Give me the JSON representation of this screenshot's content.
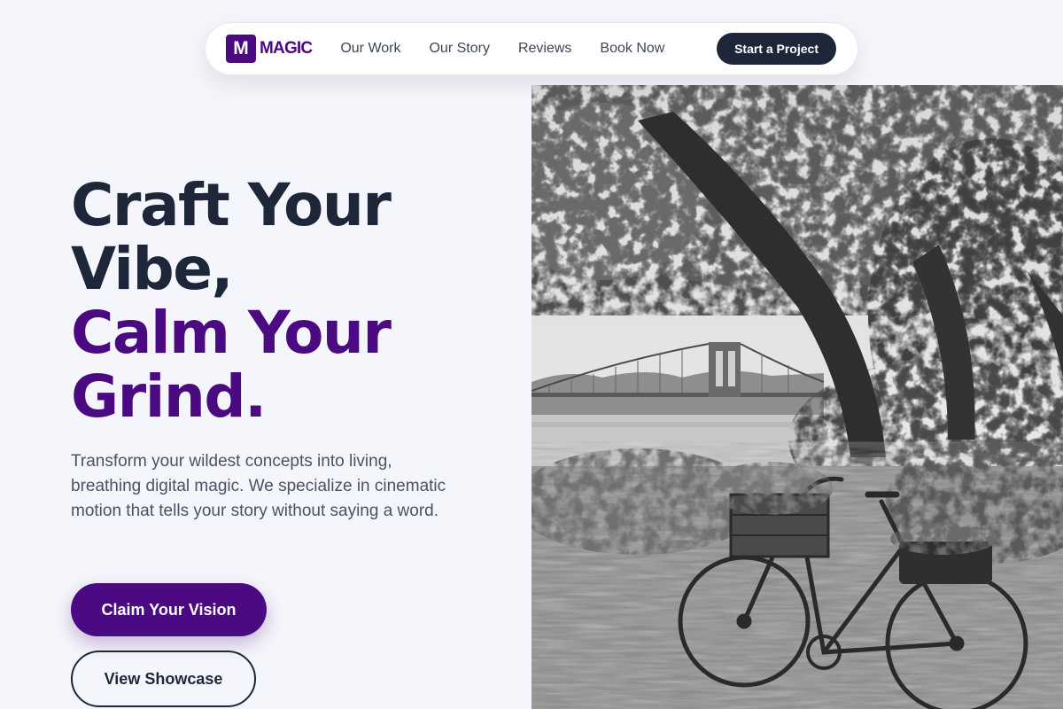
{
  "nav": {
    "logo_mark": "M",
    "logo_text": "MAGIC",
    "links": [
      {
        "label": "Our Work"
      },
      {
        "label": "Our Story"
      },
      {
        "label": "Reviews"
      },
      {
        "label": "Book Now"
      }
    ],
    "cta_label": "Start a Project"
  },
  "hero": {
    "title_line1": "Craft Your Vibe,",
    "title_line2": "Calm Your Grind.",
    "description": "Transform your wildest concepts into living, breathing digital magic. We specialize in cinematic motion that tells your story without saying a word.",
    "primary_button": "Claim Your Vision",
    "secondary_button": "View Showcase"
  },
  "image": {
    "subject": "black-and-white photo of a bicycle with a crate basket under large trees near a river and suspension bridge"
  },
  "colors": {
    "brand": "#4b0a82",
    "dark": "#1d2739",
    "background": "#f5f6fb",
    "body_text": "#4a5263"
  }
}
